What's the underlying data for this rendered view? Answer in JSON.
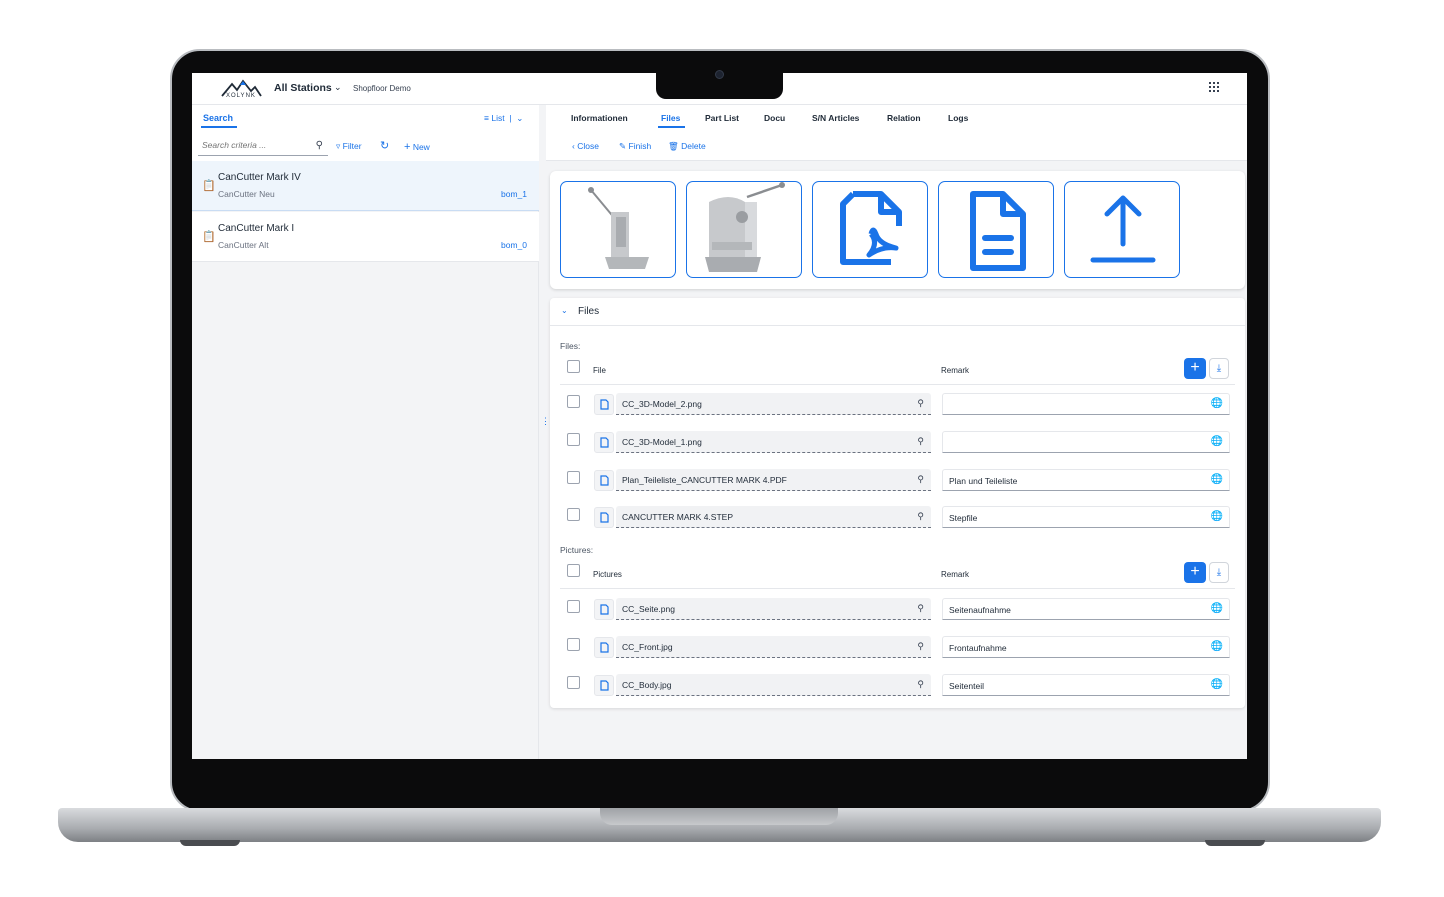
{
  "header": {
    "logo_text": "XOLYNK",
    "station": "All Stations",
    "demo": "Shopfloor Demo"
  },
  "left": {
    "tab_search": "Search",
    "view_mode": "List",
    "search_placeholder": "Search criteria ...",
    "filter_label": "Filter",
    "new_label": "New",
    "items": [
      {
        "title": "CanCutter Mark IV",
        "subtitle": "CanCutter Neu",
        "bom": "bom_1"
      },
      {
        "title": "CanCutter Mark I",
        "subtitle": "CanCutter Alt",
        "bom": "bom_0"
      }
    ]
  },
  "right": {
    "tabs": [
      "Informationen",
      "Files",
      "Part List",
      "Docu",
      "S/N Articles",
      "Relation",
      "Logs"
    ],
    "active_tab": "Files",
    "actions": {
      "close": "Close",
      "finish": "Finish",
      "delete": "Delete"
    },
    "tiles": [
      "3d-model-image",
      "3d-model-image",
      "pdf-icon",
      "document-icon",
      "upload-icon"
    ],
    "files_section": {
      "title": "Files",
      "files_label": "Files:",
      "file_col": "File",
      "remark_col": "Remark",
      "files": [
        {
          "name": "CC_3D-Model_2.png",
          "remark": ""
        },
        {
          "name": "CC_3D-Model_1.png",
          "remark": ""
        },
        {
          "name": "Plan_Teileliste_CANCUTTER MARK 4.PDF",
          "remark": "Plan und Teileliste"
        },
        {
          "name": "CANCUTTER MARK 4.STEP",
          "remark": "Stepfile"
        }
      ],
      "pictures_label": "Pictures:",
      "pictures_col": "Pictures",
      "pictures_remark_col": "Remark",
      "pictures": [
        {
          "name": "CC_Seite.png",
          "remark": "Seitenaufnahme"
        },
        {
          "name": "CC_Front.jpg",
          "remark": "Frontaufnahme"
        },
        {
          "name": "CC_Body.jpg",
          "remark": "Seitenteil"
        }
      ]
    }
  },
  "colors": {
    "accent": "#1a73e8",
    "background": "#f3f4f6"
  }
}
